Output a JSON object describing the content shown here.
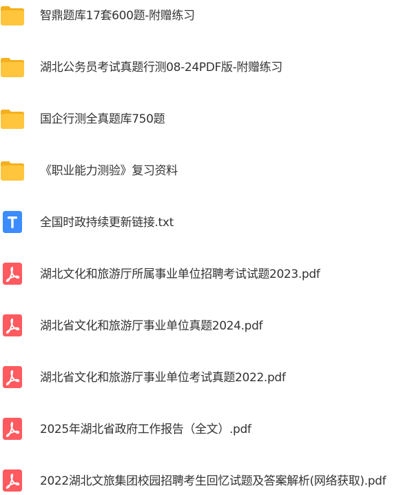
{
  "colors": {
    "folder": "#FFC53D",
    "folder_tab": "#F4B01E",
    "pdf_icon": "#FF5A5F",
    "txt_icon": "#3C8CFF",
    "text": "#333333"
  },
  "files": [
    {
      "name": "智鼎题库17套600题-附赠练习",
      "icon": "folder-icon"
    },
    {
      "name": "湖北公务员考试真题行测08-24PDF版-附赠练习",
      "icon": "folder-icon"
    },
    {
      "name": "国企行测全真题库750题",
      "icon": "folder-icon"
    },
    {
      "name": "《职业能力测验》复习资料",
      "icon": "folder-icon"
    },
    {
      "name": "全国时政持续更新链接.txt",
      "icon": "txt-file-icon"
    },
    {
      "name": "湖北文化和旅游厅所属事业单位招聘考试试题2023.pdf",
      "icon": "pdf-file-icon"
    },
    {
      "name": "湖北省文化和旅游厅事业单位真题2024.pdf",
      "icon": "pdf-file-icon"
    },
    {
      "name": "湖北省文化和旅游厅事业单位考试真题2022.pdf",
      "icon": "pdf-file-icon"
    },
    {
      "name": "2025年湖北省政府工作报告（全文）.pdf",
      "icon": "pdf-file-icon"
    },
    {
      "name": "2022湖北文旅集团校园招聘考生回忆试题及答案解析(网络获取).pdf",
      "icon": "pdf-file-icon"
    }
  ]
}
